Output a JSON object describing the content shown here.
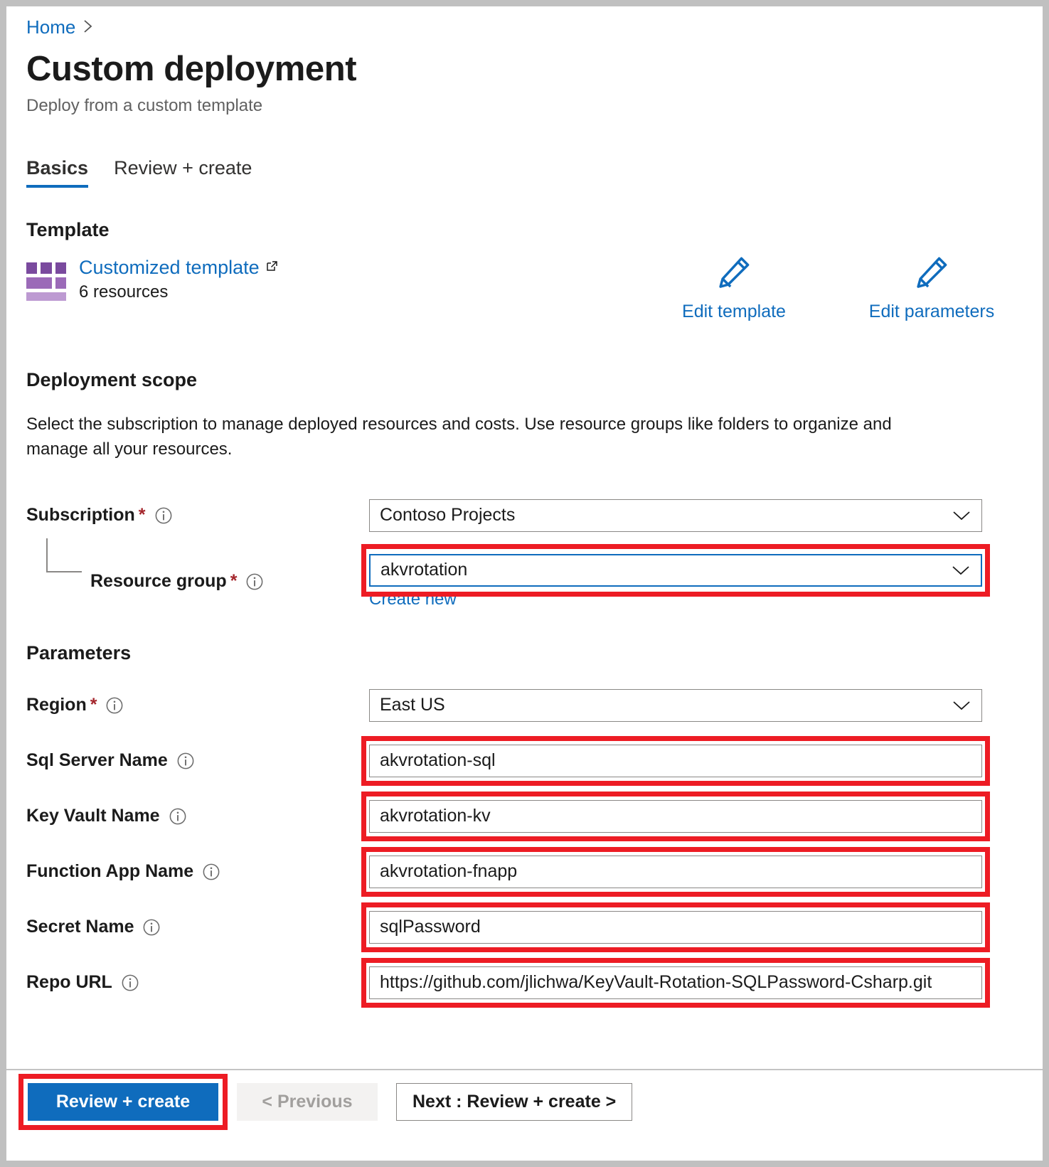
{
  "breadcrumb": {
    "home": "Home",
    "separator": "›"
  },
  "header": {
    "title": "Custom deployment",
    "subtitle": "Deploy from a custom template"
  },
  "tabs": [
    {
      "label": "Basics",
      "active": true
    },
    {
      "label": "Review + create",
      "active": false
    }
  ],
  "template": {
    "heading": "Template",
    "link_label": "Customized template",
    "resource_count": "6 resources",
    "edit_template_label": "Edit template",
    "edit_parameters_label": "Edit parameters"
  },
  "deployment_scope": {
    "heading": "Deployment scope",
    "description": "Select the subscription to manage deployed resources and costs. Use resource groups like folders to organize and manage all your resources.",
    "subscription": {
      "label": "Subscription",
      "required": "*",
      "value": "Contoso Projects"
    },
    "resource_group": {
      "label": "Resource group",
      "required": "*",
      "value": "akvrotation",
      "create_new_label": "Create new"
    }
  },
  "parameters": {
    "heading": "Parameters",
    "fields": [
      {
        "label": "Region",
        "required": "*",
        "value": "East US",
        "type": "select",
        "highlighted": false
      },
      {
        "label": "Sql Server Name",
        "required": "",
        "value": "akvrotation-sql",
        "type": "text",
        "highlighted": true
      },
      {
        "label": "Key Vault Name",
        "required": "",
        "value": "akvrotation-kv",
        "type": "text",
        "highlighted": true
      },
      {
        "label": "Function App Name",
        "required": "",
        "value": "akvrotation-fnapp",
        "type": "text",
        "highlighted": true
      },
      {
        "label": "Secret Name",
        "required": "",
        "value": "sqlPassword",
        "type": "text",
        "highlighted": true
      },
      {
        "label": "Repo URL",
        "required": "",
        "value": "https://github.com/jlichwa/KeyVault-Rotation-SQLPassword-Csharp.git",
        "type": "text",
        "highlighted": true
      }
    ]
  },
  "footer": {
    "review_create_label": "Review + create",
    "previous_label": "< Previous",
    "next_label": "Next : Review + create >"
  },
  "colors": {
    "accent_blue": "#0f6cbd",
    "annotation_red": "#ed1c24",
    "required_red": "#a4262c",
    "template_purple": "#7a4a9e"
  },
  "icons": {
    "chevron_right": "chevron-right-icon",
    "external_link": "external-link-icon",
    "pencil": "pencil-icon",
    "info": "info-icon",
    "chevron_down": "chevron-down-icon",
    "template_grid": "template-grid-icon"
  }
}
